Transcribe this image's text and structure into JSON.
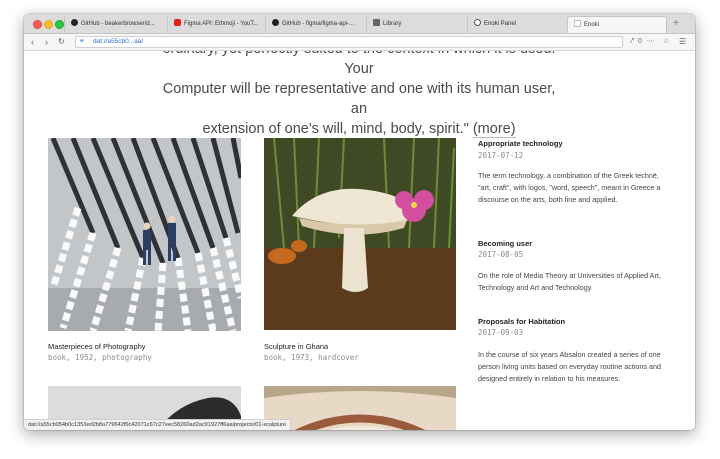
{
  "tabs": [
    {
      "label": "GitHub - beakerbrowser/d...",
      "icon": "github-icon",
      "color": "#222222"
    },
    {
      "label": "Figma API: Ethmoji - YouT...",
      "icon": "youtube-icon",
      "color": "#e62117"
    },
    {
      "label": "GitHub - figma/figma-api-...",
      "icon": "github-icon",
      "color": "#222222"
    },
    {
      "label": "Library",
      "icon": "library-icon",
      "color": "#555555"
    },
    {
      "label": "Enoki Panel",
      "icon": "enoki-icon",
      "color": "#555555"
    },
    {
      "label": "Enoki",
      "icon": "page-icon",
      "color": "#bbbbbb"
    }
  ],
  "toolbar": {
    "url": "dat://a55cb0...aa/",
    "share_count": "0"
  },
  "quote": {
    "line1": "ordinary, yet perfectly suited to the context in which it is used. Your",
    "line2": "Computer will be representative and one with its human user, an",
    "line3": "extension of one's will, mind, body, spirit.\"",
    "more": "(more)"
  },
  "cards": [
    {
      "title": "Masterpieces of Photography",
      "meta": "book, 1952, photography",
      "image": "chains-photo"
    },
    {
      "title": "Sculpture in Ghana",
      "meta": "book, 1973, hardcover",
      "image": "mushroom-photo"
    },
    {
      "title": "",
      "meta": "",
      "image": "hand-photo"
    },
    {
      "title": "",
      "meta": "",
      "image": "arch-photo"
    }
  ],
  "posts": [
    {
      "title": "Appropriate technology",
      "date": "2017-07-12",
      "body": "The term technology, a combination of the Greek technē, \"art, craft\", with logos, \"word, speech\", meant in Greece a discourse on the arts, both fine and applied."
    },
    {
      "title": "Becoming user",
      "date": "2017-08-05",
      "body": "On the role of Media Theory at Universities of Applied Art, Technology and Art and Technology."
    },
    {
      "title": "Proposals for Habitation",
      "date": "2017-09-03",
      "body": "In the course of six years Absalon created a series of one person living units based on everyday routine actions and designed entirely in relation to his measures."
    }
  ],
  "status": "dat://a55cb054b0c1353ed2b8a779642f6c42071c67c27eec58260ad2ac91927ff6aa/projects/01-sculpture"
}
